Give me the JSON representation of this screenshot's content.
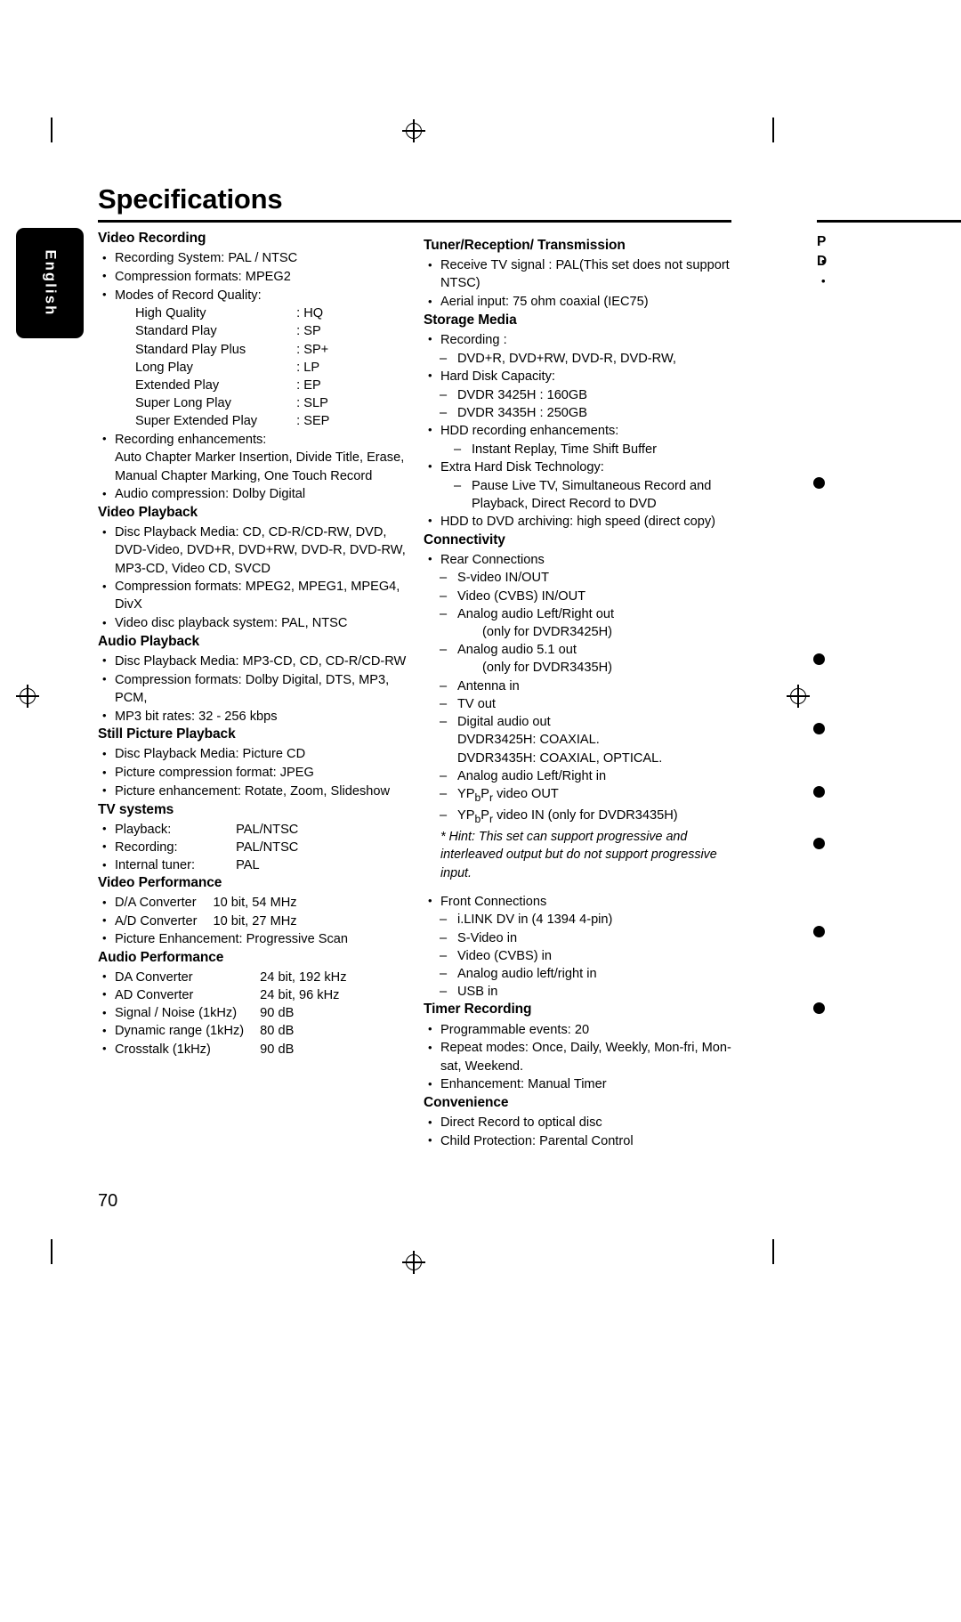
{
  "page": {
    "title": "Specifications",
    "number": "70",
    "side_tab_label": "English"
  },
  "left_column": {
    "sections": [
      {
        "heading": "Video Recording",
        "bullets": [
          "Recording System: PAL / NTSC",
          "Compression formats: MPEG2",
          "Modes of Record Quality:"
        ],
        "modes": [
          {
            "name": "High Quality",
            "code": ": HQ"
          },
          {
            "name": "Standard Play",
            "code": ": SP"
          },
          {
            "name": "Standard Play Plus",
            "code": ": SP+"
          },
          {
            "name": "Long Play",
            "code": ": LP"
          },
          {
            "name": "Extended Play",
            "code": ": EP"
          },
          {
            "name": "Super Long Play",
            "code": ": SLP"
          },
          {
            "name": "Super Extended Play",
            "code": ": SEP"
          }
        ],
        "bullets_after": [
          "Recording enhancements:",
          "Audio compression: Dolby Digital"
        ],
        "enhancement_text": "Auto Chapter Marker Insertion, Divide Title, Erase, Manual Chapter Marking, One Touch Record"
      },
      {
        "heading": "Video Playback",
        "bullets": [
          "Disc Playback Media: CD, CD-R/CD-RW, DVD, DVD-Video, DVD+R, DVD+RW, DVD-R, DVD-RW, MP3-CD, Video CD, SVCD",
          "Compression formats: MPEG2, MPEG1, MPEG4, DivX",
          "Video disc playback system: PAL, NTSC"
        ]
      },
      {
        "heading": "Audio Playback",
        "bullets": [
          "Disc Playback Media: MP3-CD, CD, CD-R/CD-RW",
          "Compression formats: Dolby Digital, DTS, MP3, PCM,",
          "MP3 bit rates: 32 - 256 kbps"
        ]
      },
      {
        "heading": "Still Picture Playback",
        "bullets": [
          "Disc Playback Media: Picture CD",
          "Picture compression format: JPEG",
          "Picture enhancement: Rotate, Zoom, Slideshow"
        ]
      },
      {
        "heading": "TV systems",
        "rows": [
          {
            "k": "Playback:",
            "v": "PAL/NTSC"
          },
          {
            "k": "Recording:",
            "v": "PAL/NTSC"
          },
          {
            "k": "Internal tuner:",
            "v": "PAL"
          }
        ]
      },
      {
        "heading": "Video Performance",
        "rows": [
          {
            "k": "D/A Converter",
            "v": "10 bit, 54 MHz"
          },
          {
            "k": "A/D Converter",
            "v": "10 bit, 27 MHz"
          }
        ],
        "bullets": [
          "Picture Enhancement: Progressive Scan"
        ]
      },
      {
        "heading": "Audio Performance",
        "rows": [
          {
            "k": "DA Converter",
            "v": "24 bit, 192 kHz"
          },
          {
            "k": "AD Converter",
            "v": "24 bit, 96 kHz"
          },
          {
            "k": "Signal / Noise (1kHz)",
            "v": "90 dB"
          },
          {
            "k": "Dynamic range (1kHz)",
            "v": "80 dB"
          },
          {
            "k": "Crosstalk (1kHz)",
            "v": "90 dB"
          }
        ]
      }
    ]
  },
  "right_column": {
    "tuner": {
      "heading": "Tuner/Reception/ Transmission",
      "bullets": [
        "Receive TV signal : PAL(This set does not support NTSC)",
        "Aerial input: 75 ohm coaxial (IEC75)"
      ]
    },
    "storage": {
      "heading": "Storage Media",
      "recording_label": "Recording :",
      "recording_media": "DVD+R, DVD+RW, DVD-R, DVD-RW,",
      "hdd_label": "Hard Disk Capacity:",
      "hdd_items": [
        "DVDR 3425H : 160GB",
        "DVDR 3435H : 250GB"
      ],
      "hdd_enh_label": "HDD recording enhancements:",
      "hdd_enh_items": [
        "Instant Replay, Time Shift Buffer"
      ],
      "extra_label": "Extra Hard Disk Technology:",
      "extra_items": [
        "Pause Live TV, Simultaneous Record and Playback, Direct Record to DVD"
      ],
      "archiving": "HDD to DVD archiving: high speed (direct copy)"
    },
    "connectivity": {
      "heading": "Connectivity",
      "rear_label": "Rear Connections",
      "rear_items": [
        "S-video IN/OUT",
        "Video (CVBS)  IN/OUT",
        "Analog audio Left/Right out",
        "Analog audio 5.1 out",
        "Antenna in",
        "TV out",
        "Digital audio out",
        "Analog audio Left/Right in",
        "YPbPr video OUT",
        "YPbPr video IN (only for DVDR3435H)"
      ],
      "note_3425_lr": "(only for DVDR3425H)",
      "note_3435_51": "(only for DVDR3435H)",
      "digital_out_1": "DVDR3425H: COAXIAL.",
      "digital_out_2": "DVDR3435H: COAXIAL, OPTICAL.",
      "hint": "* Hint: This set can support progressive and interleaved output but do not support progressive input.",
      "front_label": "Front Connections",
      "front_items": [
        "i.LINK DV in (4 1394 4-pin)",
        "S-Video in",
        "Video (CVBS) in",
        "Analog audio left/right in",
        "USB in"
      ]
    },
    "timer": {
      "heading": "Timer Recording",
      "bullets": [
        "Programmable events:  20",
        "Repeat modes: Once, Daily, Weekly, Mon-fri, Mon-sat, Weekend.",
        "Enhancement: Manual Timer"
      ]
    },
    "convenience": {
      "heading": "Convenience",
      "bullets": [
        "Direct Record to optical disc",
        "Child Protection: Parental Control"
      ]
    }
  },
  "third_column_partial": {
    "heading_1": "P",
    "bullets_1": [
      "",
      "",
      ""
    ],
    "heading_2": "D",
    "bullets_2": [
      "",
      ""
    ]
  }
}
